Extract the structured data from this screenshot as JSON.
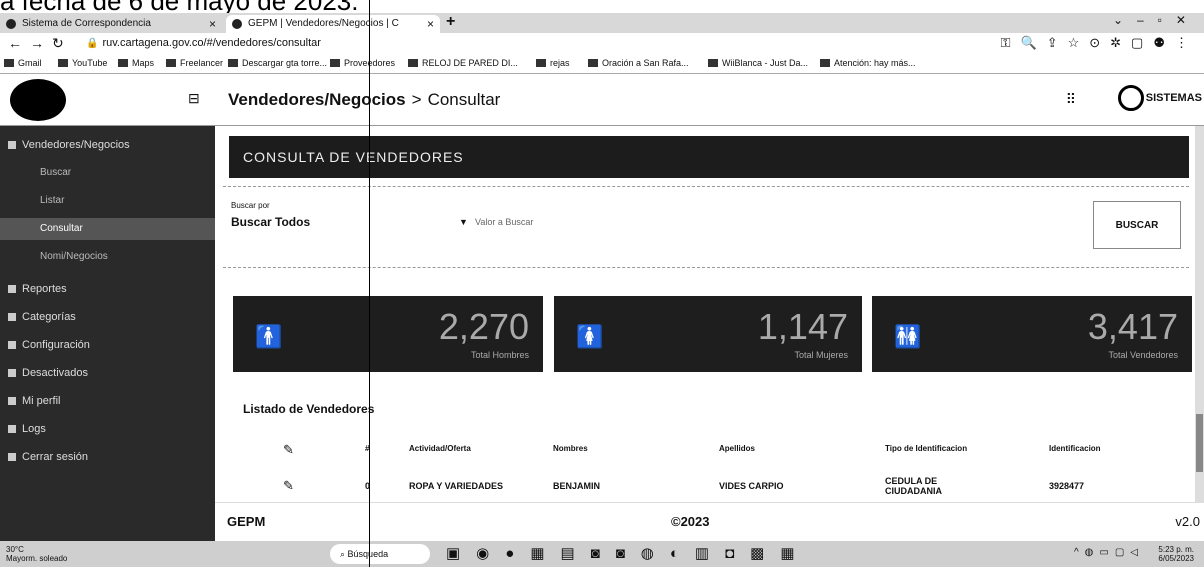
{
  "caption": "a fecha de 6 de mayo de 2023.",
  "browser": {
    "tabs": [
      {
        "label": "Sistema de Correspondencia"
      },
      {
        "label": "GEPM | Vendedores/Negocios | C"
      }
    ],
    "new_tab": "+",
    "url": "ruv.cartagena.gov.co/#/vendedores/consultar",
    "bookmarks": [
      "Gmail",
      "YouTube",
      "Maps",
      "Freelancer",
      "Descargar gta torre...",
      "Proveedores",
      "RELOJ DE PARED DI...",
      "rejas",
      "Oración a San Rafa...",
      "WiiBlanca - Just Da...",
      "Atención: hay más..."
    ]
  },
  "header": {
    "breadcrumb_root": "Vendedores/Negocios",
    "breadcrumb_sep": ">",
    "breadcrumb_current": "Consultar",
    "user": "SISTEMAS"
  },
  "sidebar": {
    "items": [
      {
        "label": "Vendedores/Negocios",
        "sub": false,
        "active": false
      },
      {
        "label": "Buscar",
        "sub": true,
        "active": false
      },
      {
        "label": "Listar",
        "sub": true,
        "active": false
      },
      {
        "label": "Consultar",
        "sub": true,
        "active": true
      },
      {
        "label": "Nomi/Negocios",
        "sub": true,
        "active": false
      },
      {
        "label": "Reportes",
        "sub": false,
        "active": false
      },
      {
        "label": "Categorías",
        "sub": false,
        "active": false
      },
      {
        "label": "Configuración",
        "sub": false,
        "active": false
      },
      {
        "label": "Desactivados",
        "sub": false,
        "active": false
      },
      {
        "label": "Mi perfil",
        "sub": false,
        "active": false
      },
      {
        "label": "Logs",
        "sub": false,
        "active": false
      },
      {
        "label": "Cerrar sesión",
        "sub": false,
        "active": false
      }
    ]
  },
  "main": {
    "banner": "CONSULTA DE VENDEDORES",
    "filter": {
      "label": "Buscar por",
      "selected": "Buscar Todos",
      "placeholder": "Valor a Buscar",
      "button": "BUSCAR"
    },
    "stats": [
      {
        "icon": "male-icon",
        "glyph": "🚹",
        "value": "2,270",
        "label": "Total Hombres"
      },
      {
        "icon": "female-icon",
        "glyph": "🚺",
        "value": "1,147",
        "label": "Total Mujeres"
      },
      {
        "icon": "couple-icon",
        "glyph": "🚻",
        "value": "3,417",
        "label": "Total Vendedores"
      }
    ],
    "list_title": "Listado de Vendedores",
    "table": {
      "headers": [
        "#",
        "Actividad/Oferta",
        "Nombres",
        "Apellidos",
        "Tipo de Identificacion",
        "Identificacion"
      ],
      "rows": [
        [
          "0",
          "ROPA Y VARIEDADES",
          "BENJAMIN",
          "VIDES CARPIO",
          "CEDULA DE CIUDADANIA",
          "3928477"
        ]
      ]
    }
  },
  "footer": {
    "left": "GEPM",
    "center": "©2023",
    "right": "v2.0"
  },
  "taskbar": {
    "weather_temp": "30°C",
    "weather_desc": "Mayorm. soleado",
    "search": "Búsqueda",
    "time": "5:23 p. m.",
    "date": "6/05/2023"
  }
}
